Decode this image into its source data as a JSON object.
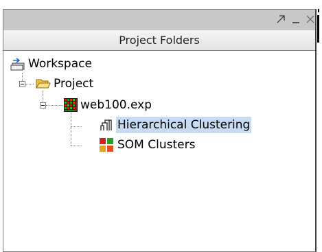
{
  "panel": {
    "title": "Project Folders",
    "controls": {
      "maximize": "↗",
      "minimize": "_",
      "close": "×"
    }
  },
  "tree": {
    "workspace": {
      "label": "Workspace",
      "icon": "workspace-icon"
    },
    "project": {
      "label": "Project",
      "icon": "open-folder-icon",
      "expanded": true
    },
    "experiment": {
      "label": "web100.exp",
      "icon": "heatmap-grid-icon",
      "expanded": true
    },
    "children": [
      {
        "label": "Hierarchical Clustering",
        "icon": "dendrogram-icon",
        "selected": true
      },
      {
        "label": "SOM Clusters",
        "icon": "som-clusters-icon",
        "selected": false
      }
    ]
  },
  "colors": {
    "selection": "#c7dcf3",
    "titlebar": "#c8c8c8",
    "folder": "#f5c542"
  }
}
